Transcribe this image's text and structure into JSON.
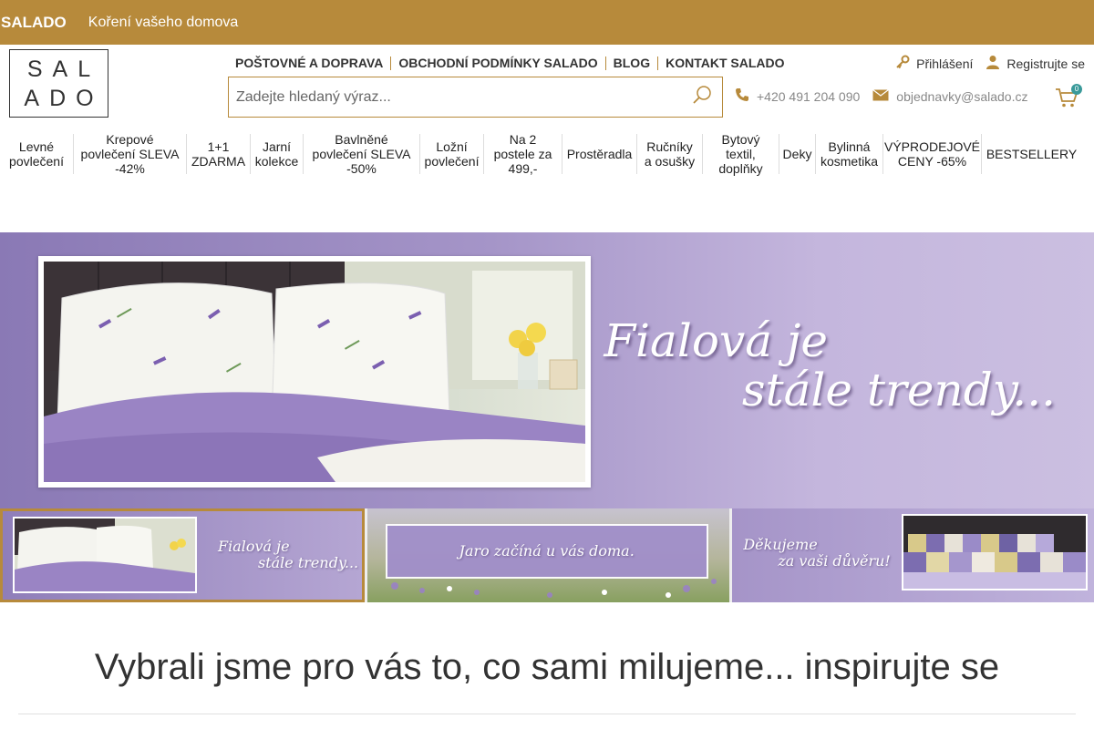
{
  "topbar": {
    "brand": "SALADO",
    "tagline": "Koření vašeho domova"
  },
  "logo": {
    "line1": "SAL",
    "line2": "ADO"
  },
  "toplinks": [
    "POŠTOVNÉ A DOPRAVA",
    "OBCHODNÍ PODMÍNKY SALADO",
    "BLOG",
    "KONTAKT SALADO"
  ],
  "account": {
    "login": "Přihlášení",
    "register": "Registrujte se"
  },
  "search": {
    "placeholder": "Zadejte hledaný výraz...",
    "value": ""
  },
  "contacts": {
    "phone": "+420 491 204 090",
    "email": "objednavky@salado.cz"
  },
  "cart": {
    "count": "0"
  },
  "menu": [
    [
      "Levné",
      "povlečení"
    ],
    [
      "Krepové",
      "povlečení SLEVA",
      "-42%"
    ],
    [
      "1+1",
      "ZDARMA"
    ],
    [
      "Jarní",
      "kolekce"
    ],
    [
      "Bavlněné",
      "povlečení SLEVA",
      "-50%"
    ],
    [
      "Ložní",
      "povlečení"
    ],
    [
      "Na 2",
      "postele za",
      "499,-"
    ],
    [
      "Prostěradla"
    ],
    [
      "Ručníky",
      "a osušky"
    ],
    [
      "Bytový",
      "textil,",
      "doplňky"
    ],
    [
      "Deky"
    ],
    [
      "Bylinná",
      "kosmetika"
    ],
    [
      "VÝPRODEJOVÉ",
      "CENY -65%"
    ],
    [
      "BESTSELLERY"
    ]
  ],
  "hero": {
    "line1": "Fialová je",
    "line2": "stále trendy..."
  },
  "thumbs": [
    {
      "line1": "Fialová je",
      "line2": "stále trendy..."
    },
    {
      "line1": "Jaro začíná u vás doma.",
      "line2": ""
    },
    {
      "line1": "Děkujeme",
      "line2": "za vaši důvěru!"
    }
  ],
  "section": {
    "title": "Vybrali jsme pro vás to, co sami milujeme... inspirujte se"
  },
  "colors": {
    "accent": "#b78a3b",
    "hero_purple": "#a595c8",
    "badge": "#3a9a9a"
  }
}
